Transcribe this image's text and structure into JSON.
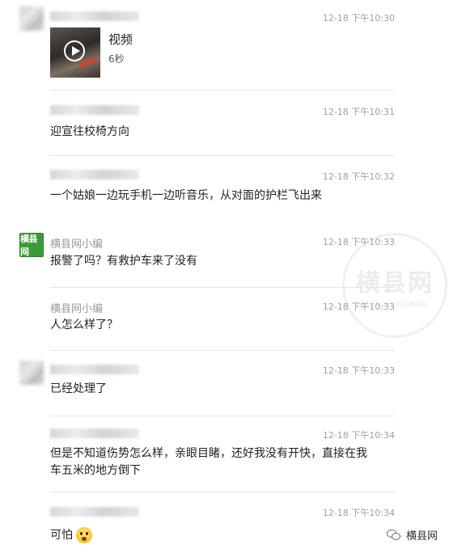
{
  "messages": [
    {
      "sender": "",
      "time": "12-18 下午10:30",
      "type": "video",
      "video_title": "视频",
      "video_duration": "6秒"
    },
    {
      "sender": "",
      "time": "12-18 下午10:31",
      "text": "迎宣往校椅方向"
    },
    {
      "sender": "",
      "time": "12-18 下午10:32",
      "text": "一个姑娘一边玩手机一边听音乐，从对面的护栏飞出来"
    },
    {
      "sender": "横县网小编",
      "time": "12-18 下午10:33",
      "text": "报警了吗？有救护车来了没有"
    },
    {
      "sender": "横县网小编",
      "time": "12-18 下午10:33",
      "text": "人怎么样了？"
    },
    {
      "sender": "",
      "time": "12-18 下午10:33",
      "text": "已经处理了"
    },
    {
      "sender": "",
      "time": "12-18 下午10:34",
      "text": "但是不知道伤势怎么样，亲眼目睹，还好我没有开快，直接在我车五米的地方倒下"
    },
    {
      "sender": "",
      "time": "12-18 下午10:34",
      "text": "可怕"
    }
  ],
  "brand_avatar_text": "横县网",
  "account_name": "横县网",
  "watermark": {
    "main": "横县网",
    "sub": "横县生活资讯品牌网站"
  }
}
